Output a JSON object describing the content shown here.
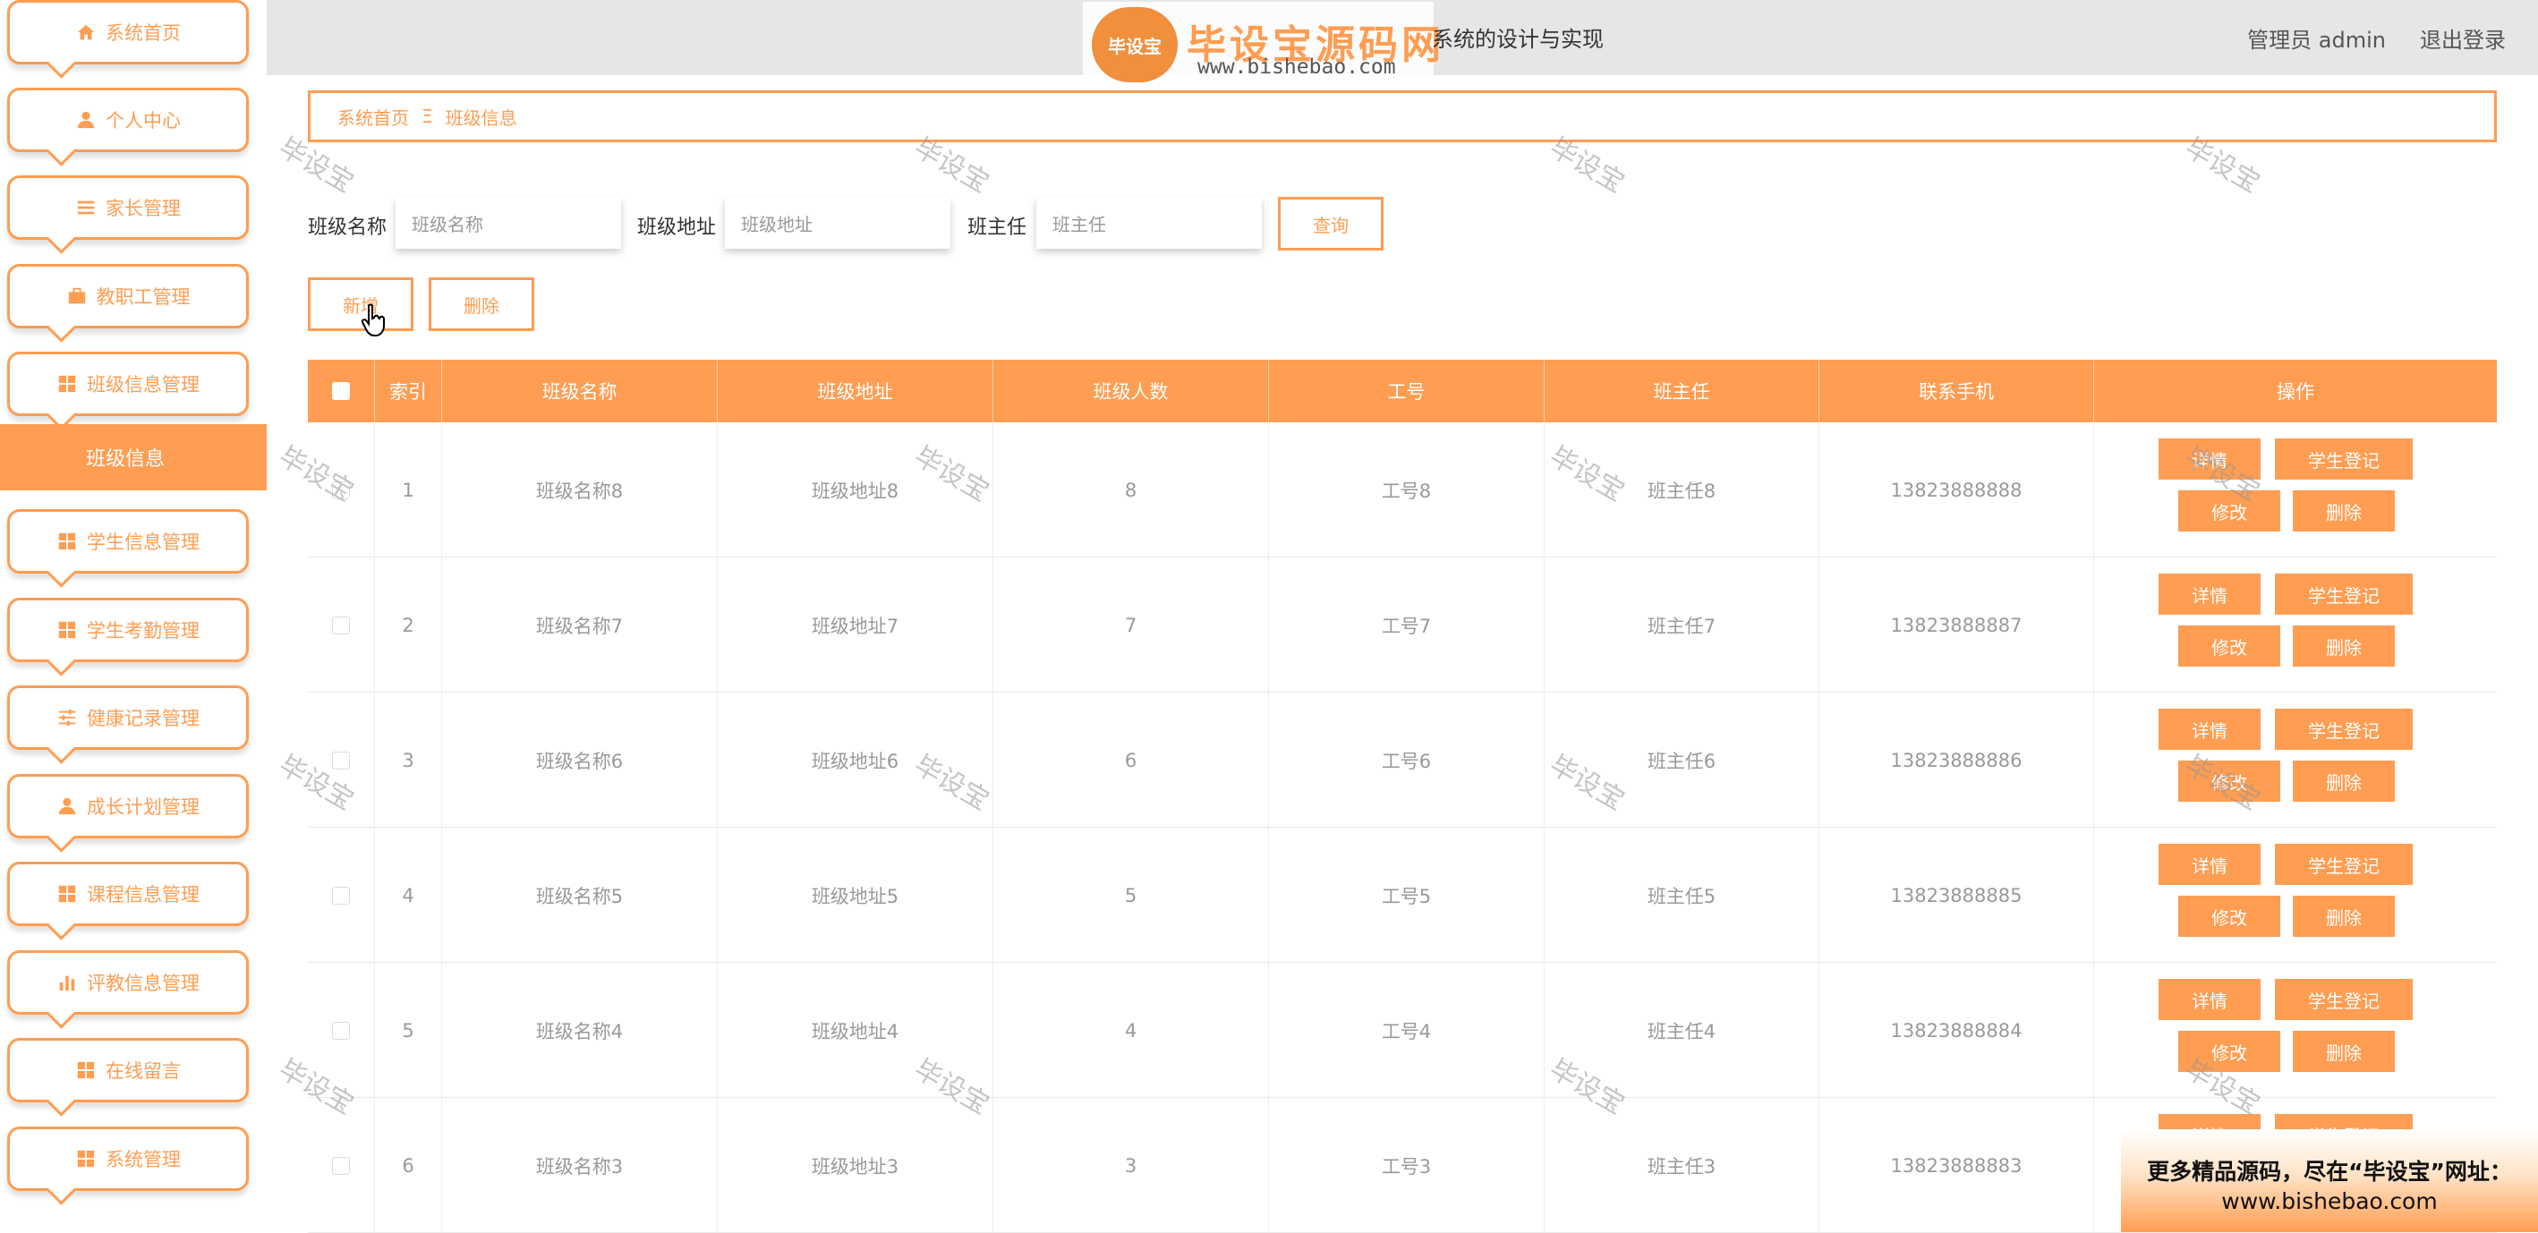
{
  "sidebar": {
    "items": [
      {
        "label": "系统首页",
        "icon": "home-icon"
      },
      {
        "label": "个人中心",
        "icon": "user-icon"
      },
      {
        "label": "家长管理",
        "icon": "menu-icon"
      },
      {
        "label": "教职工管理",
        "icon": "briefcase-icon"
      },
      {
        "label": "班级信息管理",
        "icon": "grid-icon"
      },
      {
        "label": "学生信息管理",
        "icon": "grid-icon"
      },
      {
        "label": "学生考勤管理",
        "icon": "grid-icon"
      },
      {
        "label": "健康记录管理",
        "icon": "sliders-icon"
      },
      {
        "label": "成长计划管理",
        "icon": "user-icon"
      },
      {
        "label": "课程信息管理",
        "icon": "grid-icon"
      },
      {
        "label": "评教信息管理",
        "icon": "bar-chart-icon"
      },
      {
        "label": "在线留言",
        "icon": "grid-icon"
      },
      {
        "label": "系统管理",
        "icon": "grid-icon"
      }
    ],
    "active_sub": "班级信息"
  },
  "header": {
    "logo_badge": "毕设宝",
    "logo_title": "毕设宝源码网",
    "logo_url": "www.bishebao.com",
    "title_visible": "系统的设计与实现",
    "admin": "管理员 admin",
    "logout": "退出登录"
  },
  "breadcrumb": {
    "home": "系统首页",
    "separator": "Ξ",
    "current": "班级信息"
  },
  "search": {
    "fields": [
      {
        "label": "班级名称",
        "placeholder": "班级名称"
      },
      {
        "label": "班级地址",
        "placeholder": "班级地址"
      },
      {
        "label": "班主任",
        "placeholder": "班主任"
      }
    ],
    "query_button": "查询"
  },
  "actions": {
    "add": "新增",
    "delete": "删除"
  },
  "table": {
    "headers": [
      "索引",
      "班级名称",
      "班级地址",
      "班级人数",
      "工号",
      "班主任",
      "联系手机",
      "操作"
    ],
    "op_labels": {
      "detail": "详情",
      "register": "学生登记",
      "edit": "修改",
      "delete": "删除"
    },
    "rows": [
      {
        "index": "1",
        "name": "班级名称8",
        "address": "班级地址8",
        "count": "8",
        "job_no": "工号8",
        "teacher": "班主任8",
        "phone": "13823888888"
      },
      {
        "index": "2",
        "name": "班级名称7",
        "address": "班级地址7",
        "count": "7",
        "job_no": "工号7",
        "teacher": "班主任7",
        "phone": "13823888887"
      },
      {
        "index": "3",
        "name": "班级名称6",
        "address": "班级地址6",
        "count": "6",
        "job_no": "工号6",
        "teacher": "班主任6",
        "phone": "13823888886"
      },
      {
        "index": "4",
        "name": "班级名称5",
        "address": "班级地址5",
        "count": "5",
        "job_no": "工号5",
        "teacher": "班主任5",
        "phone": "13823888885"
      },
      {
        "index": "5",
        "name": "班级名称4",
        "address": "班级地址4",
        "count": "4",
        "job_no": "工号4",
        "teacher": "班主任4",
        "phone": "13823888884"
      },
      {
        "index": "6",
        "name": "班级名称3",
        "address": "班级地址3",
        "count": "3",
        "job_no": "工号3",
        "teacher": "班主任3",
        "phone": "13823888883"
      }
    ]
  },
  "watermark": "毕设宝",
  "ad": {
    "line1": "更多精品源码，尽在“毕设宝”网址：",
    "line2": "www.bishebao.com"
  },
  "colors": {
    "accent": "#ff9d52",
    "header_bg": "#e6e6e6"
  }
}
